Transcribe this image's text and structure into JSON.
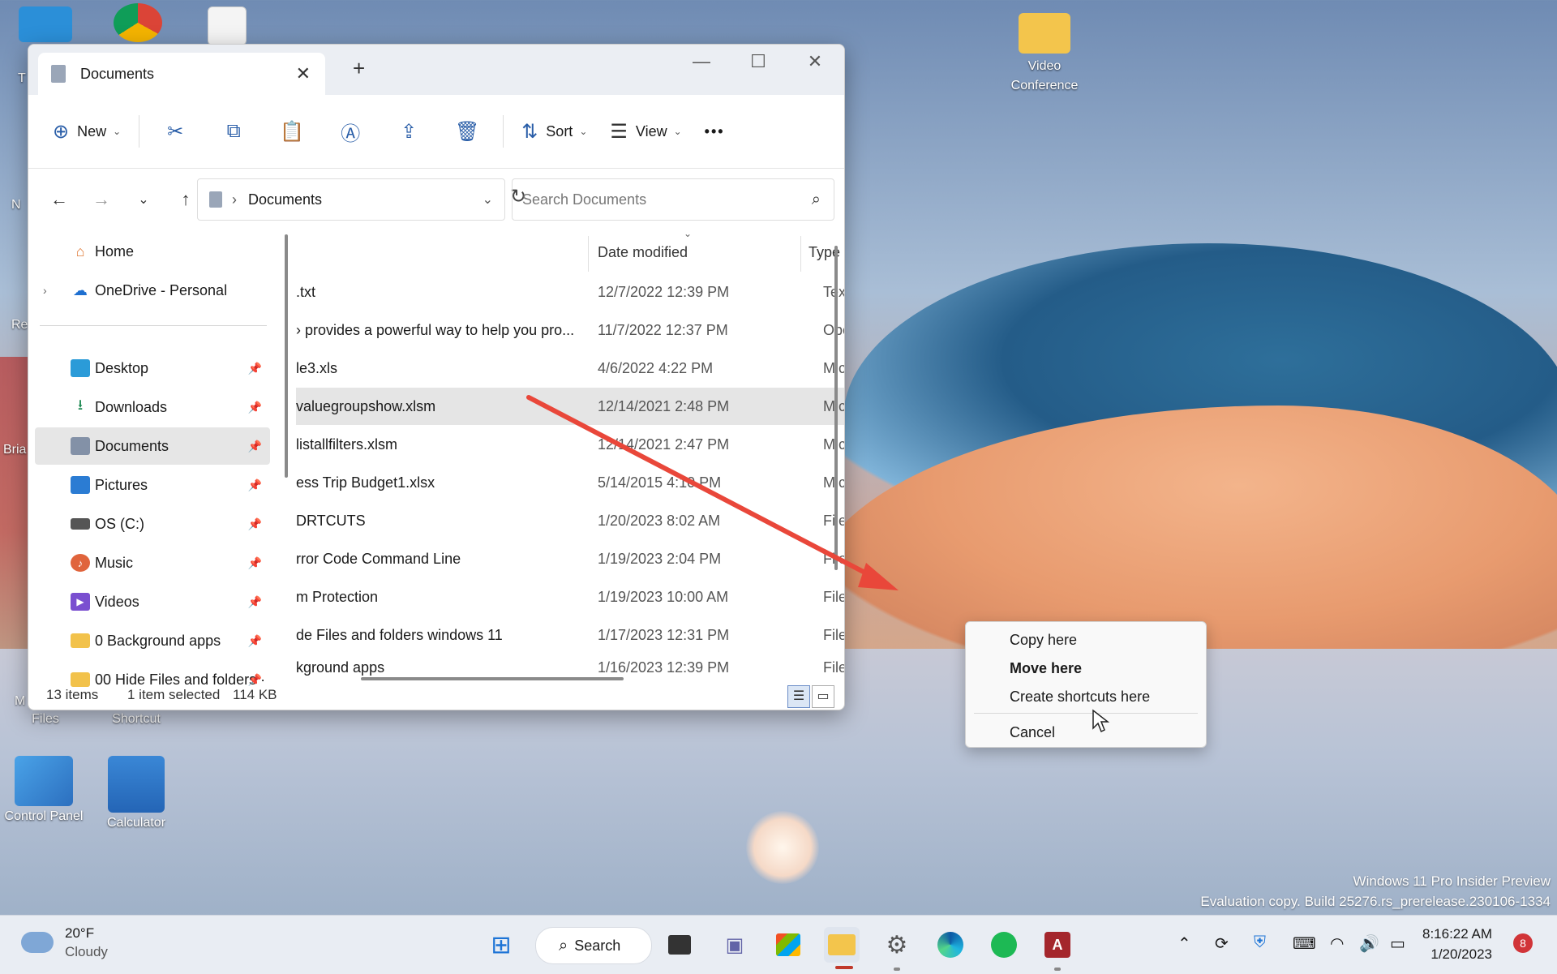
{
  "desktop": {
    "icons": [
      {
        "label": "Video\nConference",
        "icon": "folder-icon"
      },
      {
        "label": "Control Panel",
        "icon": "control-panel-icon"
      },
      {
        "label": "Calculator",
        "icon": "calculator-icon"
      },
      {
        "label": "Files",
        "icon": "files-icon"
      },
      {
        "label": "Shortcut",
        "icon": "shortcut-icon"
      }
    ],
    "partial_labels": [
      "Re",
      "Bria",
      "M",
      "N",
      "T"
    ],
    "watermark_line1": "Windows 11 Pro Insider Preview",
    "watermark_line2": "Evaluation copy. Build 25276.rs_prerelease.230106-1334"
  },
  "explorer": {
    "tab_title": "Documents",
    "new_tab_label": "+",
    "toolbar": {
      "new_label": "New",
      "sort_label": "Sort",
      "view_label": "View",
      "more_label": "•••"
    },
    "address": {
      "path": "Documents",
      "search_placeholder": "Search Documents"
    },
    "sidebar": {
      "items": [
        {
          "label": "Home",
          "icon": "home-icon",
          "color": "#e07b39"
        },
        {
          "label": "OneDrive - Personal",
          "icon": "onedrive-icon",
          "color": "#1e6fd0"
        },
        {
          "label": "Desktop",
          "icon": "desktop-icon",
          "color": "#2b9bd8"
        },
        {
          "label": "Downloads",
          "icon": "downloads-icon",
          "color": "#1f8a54"
        },
        {
          "label": "Documents",
          "icon": "documents-icon",
          "color": "#8391a7"
        },
        {
          "label": "Pictures",
          "icon": "pictures-icon",
          "color": "#2b7cd3"
        },
        {
          "label": "OS (C:)",
          "icon": "drive-icon",
          "color": "#555555"
        },
        {
          "label": "Music",
          "icon": "music-icon",
          "color": "#e0643c"
        },
        {
          "label": "Videos",
          "icon": "videos-icon",
          "color": "#7a4fd0"
        },
        {
          "label": "0 Background apps",
          "icon": "folder-icon",
          "color": "#f2c24b"
        },
        {
          "label": "00 Hide Files and folders ·",
          "icon": "folder-icon",
          "color": "#f2c24b"
        }
      ]
    },
    "columns": {
      "date": "Date modified",
      "type": "Type"
    },
    "files": [
      {
        "name": ".txt",
        "date": "12/7/2022 12:39 PM",
        "type": "Text"
      },
      {
        "name": "› provides a powerful way to help you pro...",
        "date": "11/7/2022 12:37 PM",
        "type": "Ope"
      },
      {
        "name": "le3.xls",
        "date": "4/6/2022 4:22 PM",
        "type": "Micr"
      },
      {
        "name": "valuegroupshow.xlsm",
        "date": "12/14/2021 2:48 PM",
        "type": "Micr"
      },
      {
        "name": "listallfilters.xlsm",
        "date": "12/14/2021 2:47 PM",
        "type": "Micr"
      },
      {
        "name": "ess Trip Budget1.xlsx",
        "date": "5/14/2015 4:10 PM",
        "type": "Micr"
      },
      {
        "name": "DRTCUTS",
        "date": "1/20/2023 8:02 AM",
        "type": "File"
      },
      {
        "name": "rror Code Command Line",
        "date": "1/19/2023 2:04 PM",
        "type": "File"
      },
      {
        "name": "m Protection",
        "date": "1/19/2023 10:00 AM",
        "type": "File"
      },
      {
        "name": "de Files and folders windows 11",
        "date": "1/17/2023 12:31 PM",
        "type": "File"
      },
      {
        "name": "kground apps",
        "date": "1/16/2023 12:39 PM",
        "type": "File"
      }
    ],
    "status": {
      "count": "13 items",
      "selected": "1 item selected",
      "size": "114 KB"
    }
  },
  "context_menu": {
    "copy": "Copy here",
    "move": "Move here",
    "shortcut": "Create shortcuts here",
    "cancel": "Cancel"
  },
  "taskbar": {
    "temp": "20°F",
    "condition": "Cloudy",
    "search_label": "Search",
    "time": "8:16:22 AM",
    "date": "1/20/2023",
    "notifications": "8"
  }
}
